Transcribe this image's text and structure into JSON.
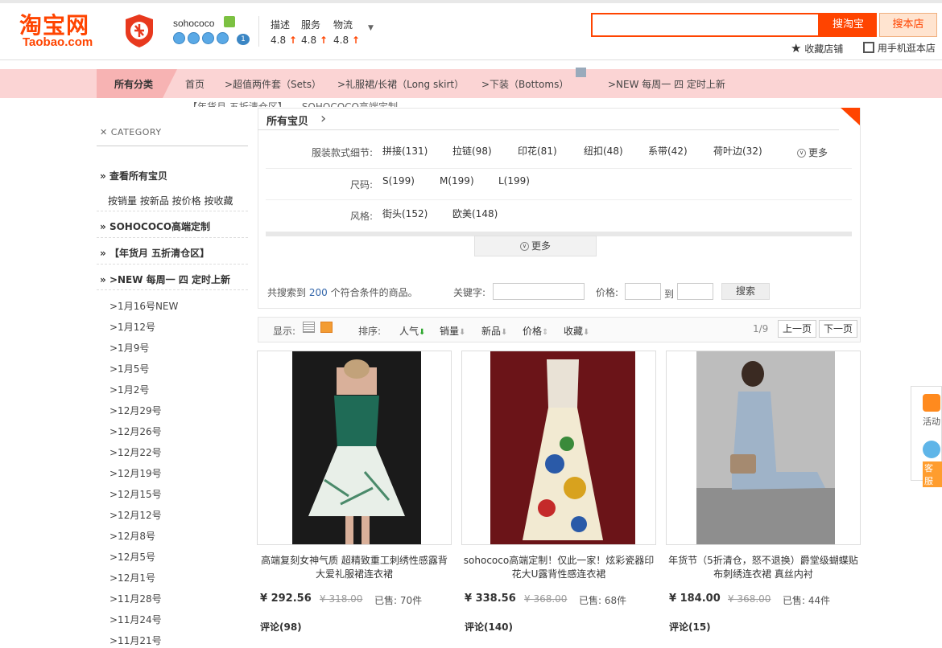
{
  "header": {
    "logo_cn": "淘宝网",
    "logo_en": "Taobao.com",
    "shop_name": "sohococo",
    "crown_level": "1",
    "ratings": [
      {
        "label": "描述",
        "score": "4.8"
      },
      {
        "label": "服务",
        "score": "4.8"
      },
      {
        "label": "物流",
        "score": "4.8"
      }
    ],
    "search_button": "搜淘宝",
    "shop_search_button": "搜本店",
    "favorite_label": "收藏店铺",
    "mobile_label": "用手机逛本店"
  },
  "nav": {
    "all_label": "所有分类",
    "items": [
      "首页",
      ">超值两件套（Sets）",
      ">礼服裙/长裙（Long skirt）",
      ">下装（Bottoms）",
      ">NEW 每周一 四 定时上新"
    ],
    "ghost_text": "【年货月 五折清仓区】　　SOHOCOCO高端定制"
  },
  "sidebar": {
    "title": "CATEGORY",
    "view_all": "查看所有宝贝",
    "sort_links": "按销量 按新品 按价格 按收藏",
    "sohococo": "SOHOCOCO高端定制",
    "clearance": "【年货月 五折清仓区】",
    "new": ">NEW 每周一 四 定时上新",
    "dates": [
      ">1月16号NEW",
      ">1月12号",
      ">1月9号",
      ">1月5号",
      ">1月2号",
      ">12月29号",
      ">12月26号",
      ">12月22号",
      ">12月19号",
      ">12月15号",
      ">12月12号",
      ">12月8号",
      ">12月5号",
      ">12月1号",
      ">11月28号",
      ">11月24号",
      ">11月21号"
    ]
  },
  "filter": {
    "title": "所有宝贝",
    "rows": [
      {
        "label": "服装款式细节:",
        "options": [
          "拼接(131)",
          "拉链(98)",
          "印花(81)",
          "纽扣(48)",
          "系带(42)",
          "荷叶边(32)"
        ]
      },
      {
        "label": "尺码:",
        "options": [
          "S(199)",
          "M(199)",
          "L(199)"
        ]
      },
      {
        "label": "风格:",
        "options": [
          "街头(152)",
          "欧美(148)"
        ]
      }
    ],
    "more_inline": "更多",
    "more_button": "更多",
    "result_prefix": "共搜索到",
    "result_count": "200",
    "result_suffix": "个符合条件的商品。",
    "keyword_label": "关键字:",
    "price_label": "价格:",
    "price_to": "到",
    "search_button": "搜索"
  },
  "sortbar": {
    "display_label": "显示:",
    "sort_label": "排序:",
    "options": [
      "人气",
      "销量",
      "新品",
      "价格",
      "收藏"
    ],
    "page_indicator": "1/9",
    "prev": "上一页",
    "next": "下一页"
  },
  "products": [
    {
      "title": "高端复刻女神气质 超精致重工刺绣性感露背大爱礼服裙连衣裙",
      "price": "¥ 292.56",
      "old_price": "¥ 318.00",
      "sold": "已售: 70件",
      "reviews": "评论(98)"
    },
    {
      "title": "sohococo高端定制！仅此一家！炫彩瓷器印花大U露背性感连衣裙",
      "price": "¥ 338.56",
      "old_price": "¥ 368.00",
      "sold": "已售: 68件",
      "reviews": "评论(140)"
    },
    {
      "title": "年货节（5折清仓，怒不退换）爵堂级蝴蝶贴布刺绣连衣裙 真丝内衬",
      "price": "¥ 184.00",
      "old_price": "¥ 368.00",
      "sold": "已售: 44件",
      "reviews": "评论(15)"
    }
  ],
  "float": {
    "sale_label": "活动",
    "service_label": "客服"
  }
}
